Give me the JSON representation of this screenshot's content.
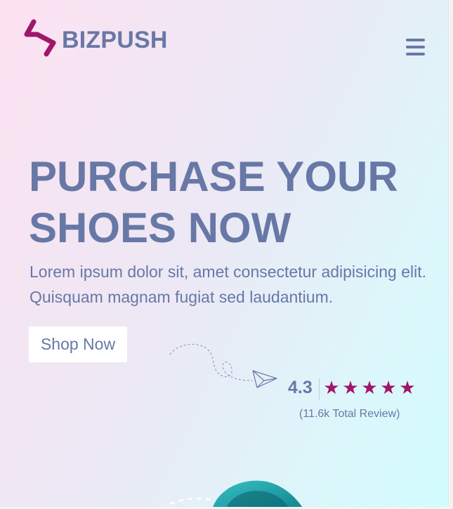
{
  "brand": {
    "name": "BIZPUSH",
    "logo_color": "#a0166a",
    "text_color": "#6878a6"
  },
  "header": {
    "menu_icon": "hamburger-menu-icon"
  },
  "hero": {
    "title_lines": [
      "PURCHASE YOUR",
      "SHOES NOW"
    ],
    "description": "Lorem ipsum dolor sit, amet consectetur adipisicing elit. Quisquam magnam fugiat sed laudantium.",
    "cta_label": "Shop Now"
  },
  "rating": {
    "value": "4.3",
    "stars": [
      "★",
      "★",
      "★",
      "★",
      "★"
    ],
    "star_count": 5,
    "review_text": "(11.6k Total Review)",
    "star_color": "#a0166a"
  },
  "decorations": {
    "paper_plane_icon": "paper-plane-icon",
    "product_image": "teal-shoe-image"
  },
  "colors": {
    "primary_text": "#6878a6",
    "accent": "#a0166a",
    "button_bg": "#ffffff",
    "gradient_start": "#fde2f1",
    "gradient_end": "#d2fdfd"
  }
}
